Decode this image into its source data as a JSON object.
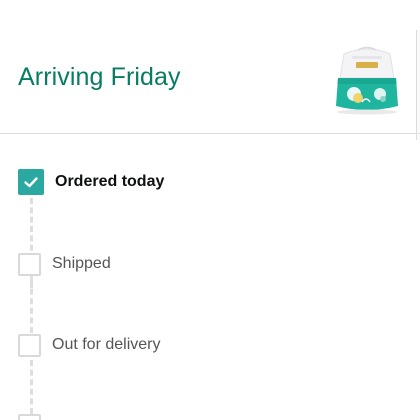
{
  "header": {
    "title": "Arriving Friday",
    "product_image_name": "diaper-pack-image"
  },
  "colors": {
    "title_green": "#067d62",
    "check_teal": "#2ba8a0",
    "box_border": "#d9d9d9",
    "connector": "#dedede"
  },
  "progress": {
    "steps": [
      {
        "label": "Ordered today",
        "completed": true
      },
      {
        "label": "Shipped",
        "completed": false
      },
      {
        "label": "Out for delivery",
        "completed": false
      },
      {
        "label": "",
        "completed": false
      }
    ]
  }
}
